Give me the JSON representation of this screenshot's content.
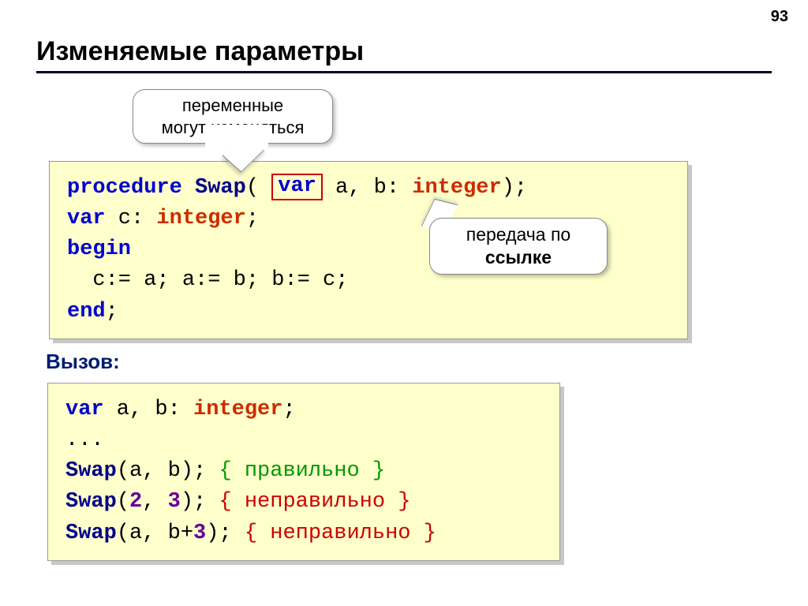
{
  "page_number": "93",
  "title": "Изменяемые параметры",
  "callout_top_line1": "переменные",
  "callout_top_line2": "могут изменяться",
  "callout_right_line1": "передача по",
  "callout_right_line2": "ссылке",
  "call_heading": "Вызов:",
  "code1": {
    "kw_procedure": "procedure",
    "name_swap": "Swap",
    "paren_open": "(",
    "kw_var_boxed": "var",
    "ab": " a, b: ",
    "type_int": "integer",
    "paren_close": ");",
    "line2a": "var c: ",
    "line2b": ";",
    "kw_begin": "begin",
    "line4": "  c:= a; a:= b; b:= c;",
    "kw_end": "end",
    "semi": ";"
  },
  "code2": {
    "kw_var": "var",
    "line1b": " a, b: ",
    "type_int": "integer",
    "semi": ";",
    "dots": "...",
    "swap": "Swap",
    "call1_args": "(a, b); ",
    "cmt1": "{ правильно }",
    "call2_open": "(",
    "n2": "2",
    "sep": ", ",
    "n3": "3",
    "call2_close": "); ",
    "cmt2": "{ неправильно }",
    "call3_args": "(a, b+",
    "call3_args2": "); ",
    "cmt3": "{ неправильно }"
  }
}
